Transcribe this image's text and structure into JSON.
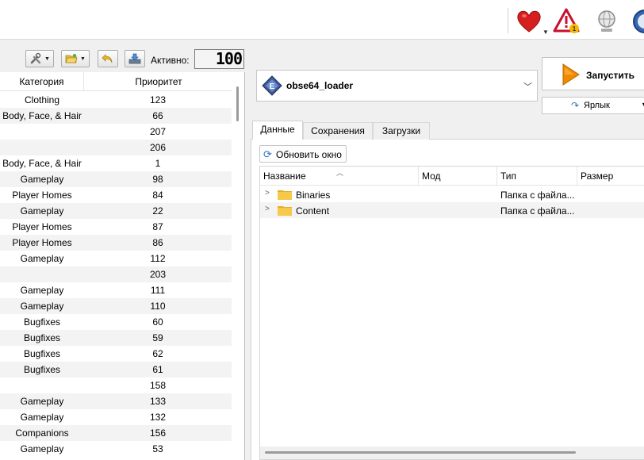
{
  "left_toolbar": {
    "active_label": "Активно:",
    "active_count": "100"
  },
  "modlist": {
    "columns": [
      "Категория",
      "Приоритет"
    ],
    "rows": [
      {
        "category": "Clothing",
        "priority": "123"
      },
      {
        "category": "Body, Face, & Hair",
        "priority": "66"
      },
      {
        "category": "",
        "priority": "207"
      },
      {
        "category": "",
        "priority": "206"
      },
      {
        "category": "Body, Face, & Hair",
        "priority": "1"
      },
      {
        "category": "Gameplay",
        "priority": "98"
      },
      {
        "category": "Player Homes",
        "priority": "84"
      },
      {
        "category": "Gameplay",
        "priority": "22"
      },
      {
        "category": "Player Homes",
        "priority": "87"
      },
      {
        "category": "Player Homes",
        "priority": "86"
      },
      {
        "category": "Gameplay",
        "priority": "112"
      },
      {
        "category": "",
        "priority": "203"
      },
      {
        "category": "Gameplay",
        "priority": "111"
      },
      {
        "category": "Gameplay",
        "priority": "110"
      },
      {
        "category": "Bugfixes",
        "priority": "60"
      },
      {
        "category": "Bugfixes",
        "priority": "59"
      },
      {
        "category": "Bugfixes",
        "priority": "62"
      },
      {
        "category": "Bugfixes",
        "priority": "61"
      },
      {
        "category": "",
        "priority": "158"
      },
      {
        "category": "Gameplay",
        "priority": "133"
      },
      {
        "category": "Gameplay",
        "priority": "132"
      },
      {
        "category": "Companions",
        "priority": "156"
      },
      {
        "category": "Gameplay",
        "priority": "53"
      }
    ]
  },
  "executable": {
    "selected": "obse64_loader"
  },
  "run_button": {
    "label": "Запустить"
  },
  "shortcut_button": {
    "label": "Ярлык"
  },
  "tabs": [
    {
      "label": "Данные",
      "active": true
    },
    {
      "label": "Сохранения",
      "active": false
    },
    {
      "label": "Загрузки",
      "active": false
    }
  ],
  "data_tab": {
    "refresh_label": "Обновить окно",
    "columns": [
      "Название",
      "Мод",
      "Тип",
      "Размер"
    ],
    "rows": [
      {
        "name": "Binaries",
        "mod": "",
        "type": "Папка с файла..."
      },
      {
        "name": "Content",
        "mod": "",
        "type": "Папка с файла..."
      }
    ]
  },
  "colors": {
    "heart": "#d61f1f",
    "warning_red": "#c8102e",
    "badge": "#f5b800",
    "run_orange": "#f08a00",
    "folder": "#f2c13b",
    "row_alt": "#f3f3f3"
  }
}
